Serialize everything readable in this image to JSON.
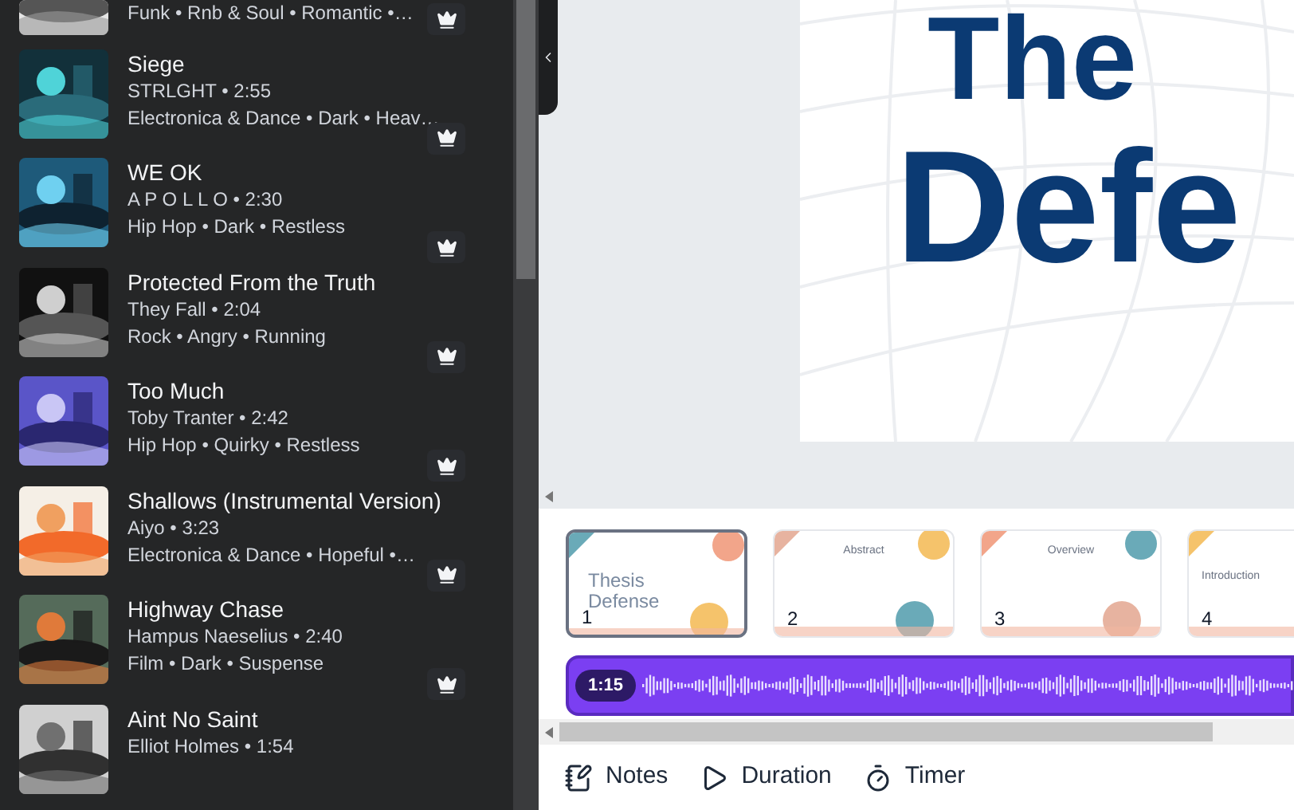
{
  "tracks": [
    {
      "tags": "Funk • Rnb & Soul • Romantic •…",
      "premium": true
    },
    {
      "title": "Siege",
      "meta": "STRLGHT • 2:55",
      "tags": "Electronica & Dance • Dark • Heav…",
      "premium": true
    },
    {
      "title": "WE OK",
      "meta": "A P O L L O • 2:30",
      "tags": "Hip Hop • Dark • Restless",
      "premium": true
    },
    {
      "title": "Protected From the Truth",
      "meta": "They Fall • 2:04",
      "tags": "Rock • Angry • Running",
      "premium": true
    },
    {
      "title": "Too Much",
      "meta": "Toby Tranter • 2:42",
      "tags": "Hip Hop • Quirky • Restless",
      "premium": true
    },
    {
      "title": "Shallows (Instrumental Version)",
      "meta": "Aiyo • 3:23",
      "tags": "Electronica & Dance • Hopeful •…",
      "premium": true
    },
    {
      "title": "Highway Chase",
      "meta": "Hampus Naeselius • 2:40",
      "tags": "Film • Dark • Suspense",
      "premium": true
    },
    {
      "title": "Aint No Saint",
      "meta": "Elliot Holmes • 1:54"
    }
  ],
  "slide": {
    "lines": [
      "The",
      "Defe"
    ]
  },
  "pages": [
    {
      "number": "1",
      "title": "Thesis Defense",
      "selected": true
    },
    {
      "number": "2",
      "title": "Abstract",
      "selected": false
    },
    {
      "number": "3",
      "title": "Overview",
      "selected": false
    },
    {
      "number": "4",
      "title": "Introduction",
      "selected": false
    }
  ],
  "audio": {
    "time": "1:15"
  },
  "toolbar": [
    {
      "kind": "notes",
      "label": "Notes"
    },
    {
      "kind": "duration",
      "label": "Duration"
    },
    {
      "kind": "timer",
      "label": "Timer"
    }
  ]
}
